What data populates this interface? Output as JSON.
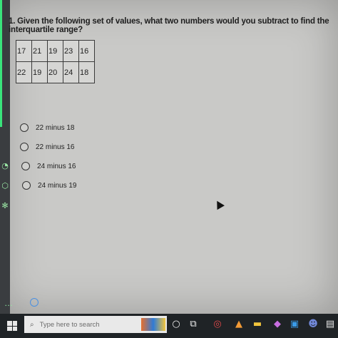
{
  "question": {
    "text": "1. Given the following set of values, what two numbers would you subtract to find the interquartile range?"
  },
  "values_table": {
    "rows": [
      [
        "17",
        "21",
        "19",
        "23",
        "16"
      ],
      [
        "22",
        "19",
        "20",
        "24",
        "18"
      ]
    ]
  },
  "options": [
    {
      "label": "22 minus 18"
    },
    {
      "label": "22 minus 16"
    },
    {
      "label": "24 minus 16"
    },
    {
      "label": "24 minus 19"
    }
  ],
  "taskbar": {
    "search_placeholder": "Type here to search"
  },
  "colors": {
    "page_background": "#c9c9c7",
    "taskbar": "#1f2326",
    "accent_green": "#39e47b"
  },
  "icons": [
    "clock-icon",
    "windows-start-icon",
    "search-icon",
    "task-view-icon",
    "file-explorer-icon",
    "chrome-icon",
    "office-icon",
    "photos-icon",
    "discord-icon"
  ]
}
